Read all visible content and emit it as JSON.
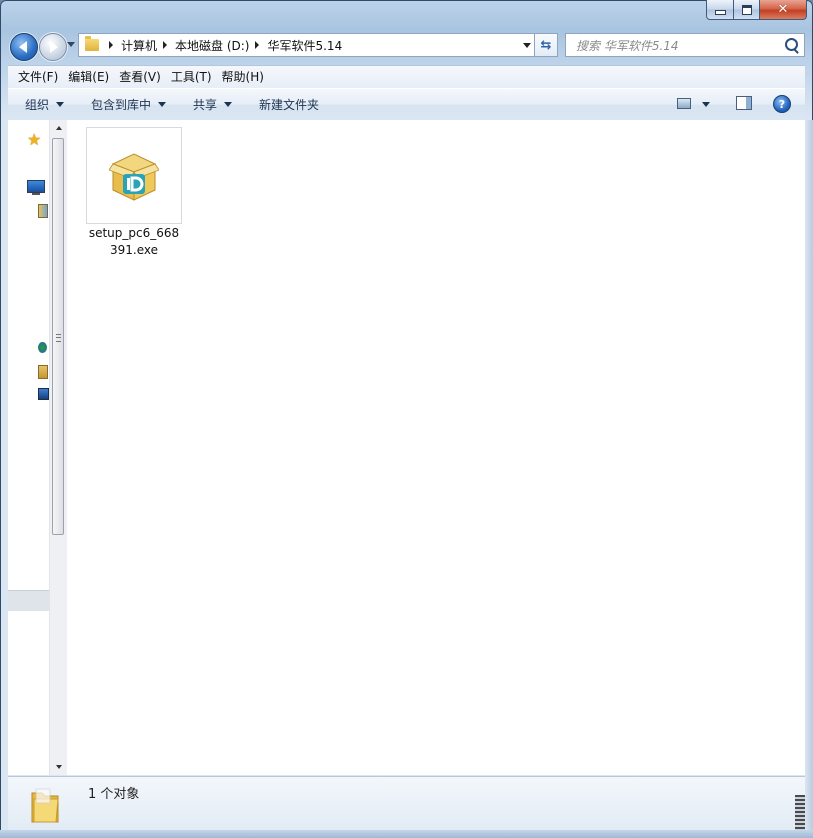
{
  "window": {
    "controls": {
      "minimize_icon": "minimize-icon",
      "maximize_icon": "maximize-icon",
      "close_glyph": "✕"
    }
  },
  "address_bar": {
    "breadcrumbs": [
      "计算机",
      "本地磁盘 (D:)",
      "华军软件5.14"
    ]
  },
  "search": {
    "placeholder": "搜索 华军软件5.14"
  },
  "menubar": {
    "items": [
      "文件(F)",
      "编辑(E)",
      "查看(V)",
      "工具(T)",
      "帮助(H)"
    ]
  },
  "toolbar": {
    "organize": "组织",
    "include_in_library": "包含到库中",
    "share": "共享",
    "new_folder": "新建文件夹",
    "help_glyph": "?"
  },
  "files": [
    {
      "name": "setup_pc6_668391.exe",
      "icon": "installer-box-icon"
    }
  ],
  "status": {
    "count_text": "1 个对象"
  },
  "colors": {
    "accent": "#1e5fb8",
    "window_frame": "#a9c4e0",
    "close": "#c23f22"
  }
}
